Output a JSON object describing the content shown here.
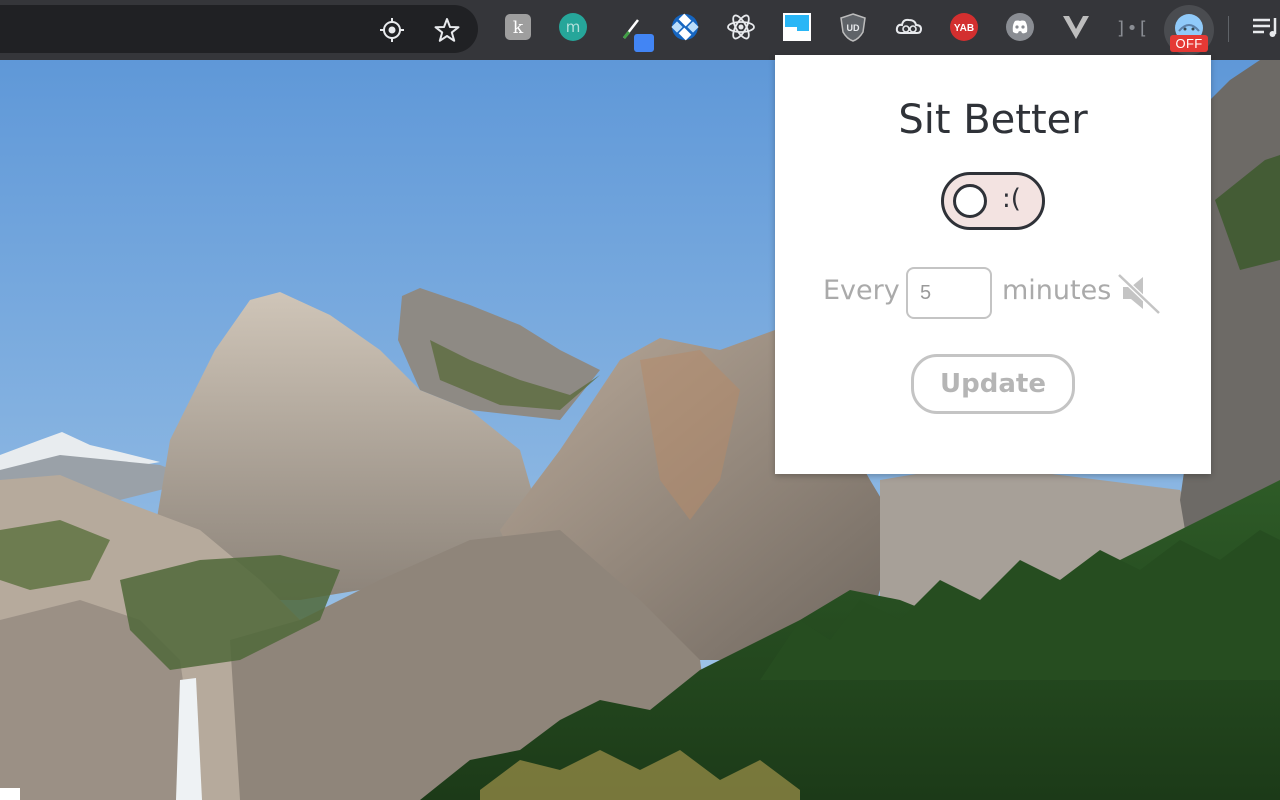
{
  "toolbar": {
    "omnibox_icons": [
      "location-target-icon",
      "bookmark-star-icon"
    ],
    "extensions": [
      {
        "name": "karma-extension-icon",
        "glyph": "k",
        "bg": "#9e9e9e"
      },
      {
        "name": "mate-translate-icon",
        "glyph": "m",
        "bg": "#26a69a"
      },
      {
        "name": "color-picker-icon",
        "glyph": "",
        "bg": "#4285f4"
      },
      {
        "name": "puzzle-extension-icon",
        "glyph": "",
        "bg": "#1565c0"
      },
      {
        "name": "react-devtools-icon",
        "glyph": "",
        "bg": "#35363a"
      },
      {
        "name": "window-resizer-icon",
        "glyph": "",
        "bg": "#29b6f6"
      },
      {
        "name": "ublock-origin-icon",
        "glyph": "UD",
        "bg": "#5f6368"
      },
      {
        "name": "cloud-sync-icon",
        "glyph": "",
        "bg": "#35363a"
      },
      {
        "name": "yab-extension-icon",
        "glyph": "YAB",
        "bg": "#d32f2f"
      },
      {
        "name": "discord-icon",
        "glyph": "",
        "bg": "#8a8d93"
      },
      {
        "name": "vue-devtools-icon",
        "glyph": "V",
        "bg": "#35363a"
      },
      {
        "name": "code-bracket-extension-icon",
        "glyph": "]•[",
        "bg": "#35363a"
      },
      {
        "name": "sit-better-extension-icon",
        "glyph": "",
        "bg": "#90caf9"
      }
    ],
    "badge_text": "OFF",
    "menu_icon": "media-queue-icon"
  },
  "popup": {
    "title": "Sit Better",
    "toggle_label": ":(",
    "every_label": "Every",
    "interval_value": "5",
    "minutes_label": "minutes",
    "sound_icon": "speaker-muted-icon",
    "update_label": "Update"
  },
  "colors": {
    "toolbar_bg": "#35363a",
    "omnibox_bg": "#202124",
    "popup_bg": "#ffffff",
    "title_color": "#2f3238",
    "toggle_bg": "#f3e3e1",
    "muted_text": "#aaaaaa",
    "badge_bg": "#e53935"
  }
}
